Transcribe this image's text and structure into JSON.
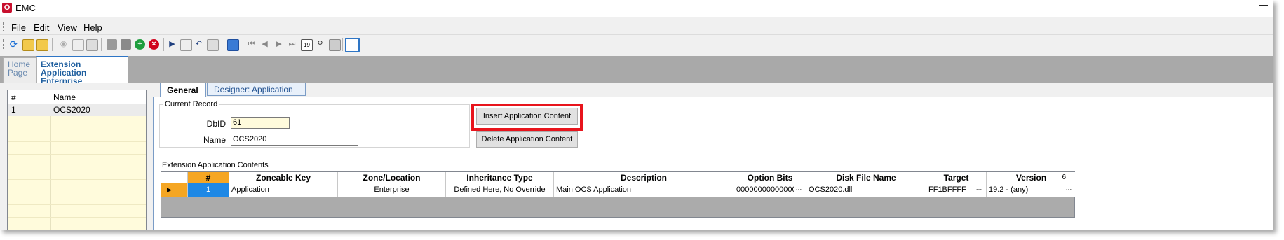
{
  "window": {
    "title": "EMC",
    "app_icon": "oracle-logo-icon",
    "minimize": "—"
  },
  "menu": [
    "File",
    "Edit",
    "View",
    "Help"
  ],
  "toolbar": {
    "icons": [
      "refresh-icon",
      "new-folder-icon",
      "open-folder-icon",
      "disabled-icon",
      "preview-icon",
      "print-icon",
      "save-icon",
      "save-all-icon",
      "add-record-icon",
      "delete-record-icon",
      "run-icon",
      "copy-icon",
      "undo-icon",
      "paste-icon",
      "table-icon",
      "first-record-icon",
      "previous-record-icon",
      "next-record-icon",
      "last-record-icon",
      "go-to-record-icon",
      "find-icon",
      "filter-icon",
      "grid-view-icon"
    ]
  },
  "doc_tabs": [
    {
      "line1": "Home",
      "line2": "Page"
    },
    {
      "line1": "Extension Application",
      "line2": "Enterprise"
    }
  ],
  "left_grid": {
    "headers": [
      "#",
      "Name"
    ],
    "rows": [
      {
        "num": "1",
        "name": "OCS2020"
      }
    ]
  },
  "inner_tabs": [
    "General",
    "Designer: Application"
  ],
  "current_record": {
    "group_label": "Current Record",
    "dbid_label": "DbID",
    "dbid_value": "61",
    "name_label": "Name",
    "name_value": "OCS2020"
  },
  "buttons": {
    "insert": "Insert Application Content",
    "delete": "Delete Application Content"
  },
  "contents": {
    "label": "Extension Application Contents",
    "headers": [
      "#",
      "Zoneable Key",
      "Zone/Location",
      "Inheritance Type",
      "Description",
      "Option Bits",
      "Disk File Name",
      "Target",
      "Version"
    ],
    "version_count": "6",
    "row": {
      "num": "1",
      "zoneable_key": "Application",
      "zone": "Enterprise",
      "inheritance": "Defined Here, No Override",
      "description": "Main OCS Application",
      "option_bits": "0000000000000000",
      "disk_file": "OCS2020.dll",
      "target": "FF1BFFFF",
      "version": "19.2 - (any)"
    },
    "ellipsis": "..."
  },
  "colors": {
    "highlight": "#e8141c",
    "selected_cell": "#1e88e5",
    "row_indicator": "#f5a623"
  }
}
